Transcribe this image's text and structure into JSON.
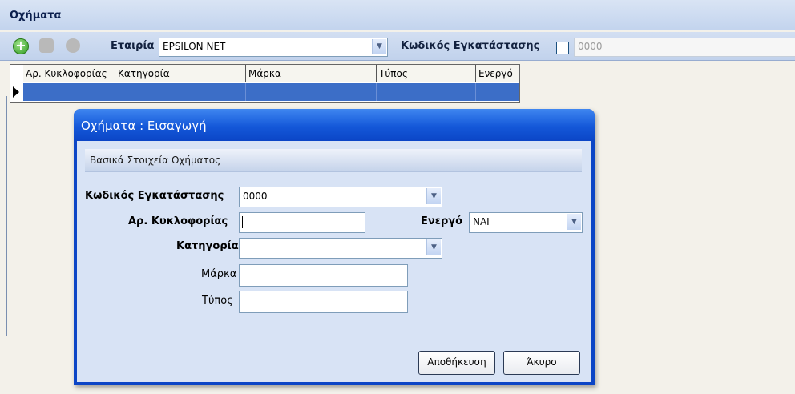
{
  "window": {
    "title": "Οχήματα"
  },
  "toolbar": {
    "add_icon": "add-icon",
    "edit_icon": "edit-icon",
    "delete_icon": "delete-icon",
    "company_label": "Εταιρία",
    "company_value": "EPSILON NET",
    "install_code_label": "Κωδικός Εγκατάστασης",
    "install_code_placeholder": "0000"
  },
  "grid": {
    "columns": [
      "Αρ. Κυκλοφορίας",
      "Κατηγορία",
      "Μάρκα",
      "Τύπος",
      "Ενεργό"
    ]
  },
  "dialog": {
    "title": "Οχήματα : Εισαγωγή",
    "section_title": "Βασικά Στοιχεία Οχήματος",
    "fields": {
      "install_code_label": "Κωδικός Εγκατάστασης",
      "install_code_value": "0000",
      "plate_label": "Αρ. Κυκλοφορίας",
      "plate_value": "",
      "active_label": "Ενεργό",
      "active_value": "ΝΑΙ",
      "category_label": "Κατηγορία",
      "category_value": "",
      "brand_label": "Μάρκα",
      "brand_value": "",
      "type_label": "Τύπος",
      "type_value": ""
    },
    "save_label": "Αποθήκευση",
    "cancel_label": "Άκυρο"
  },
  "colors": {
    "selection": "#3c6ec7",
    "dialog_title": "#0b45c6",
    "dialog_body": "#d8e3f5"
  }
}
